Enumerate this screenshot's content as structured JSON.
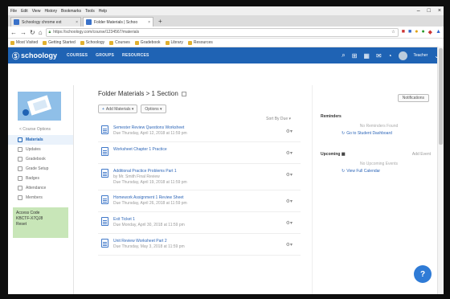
{
  "browser": {
    "menu": [
      "File",
      "Edit",
      "View",
      "History",
      "Bookmarks",
      "Tools",
      "Help"
    ],
    "window_controls": [
      "–",
      "□",
      "×"
    ],
    "tabs": [
      {
        "title": "Schoology chrome ext",
        "active": false
      },
      {
        "title": "Folder Materials | Schoo",
        "active": true
      }
    ],
    "new_tab": "+",
    "url": "https://schoology.com/course/1234567/materials",
    "bookmarks": [
      "Most Visited",
      "Getting Started",
      "Schoology",
      "Courses",
      "Gradebook",
      "Library",
      "Resources"
    ]
  },
  "appbar": {
    "logo": "schoology",
    "nav": [
      "COURSES",
      "GROUPS",
      "RESOURCES"
    ],
    "user_name": "Teacher"
  },
  "sidebar": {
    "back_label": "< Course Options",
    "items": [
      {
        "label": "Materials",
        "active": true
      },
      {
        "label": "Updates",
        "active": false
      },
      {
        "label": "Gradebook",
        "active": false
      },
      {
        "label": "Grade Setup",
        "active": false
      },
      {
        "label": "Badges",
        "active": false
      },
      {
        "label": "Attendance",
        "active": false
      },
      {
        "label": "Members",
        "active": false
      }
    ],
    "access_code": {
      "label": "Access Code",
      "code": "KBCTF-X7QJ8",
      "action": "Reset"
    }
  },
  "main": {
    "folder_title": "Folder Materials > 1 Section",
    "add_materials": "Add Materials",
    "options": "Options",
    "sort_label": "Sort By Due ▾",
    "items": [
      {
        "title": "Semester Review Questions Worksheet",
        "sub": "Due Thursday, April 12, 2018 at 11:59 pm"
      },
      {
        "title": "Worksheet Chapter 1 Practice",
        "sub": ""
      },
      {
        "title": "Additional Practice Problems Part 1",
        "sub": "by Mr. Smith Final Review",
        "sub2": "Due Thursday, April 19, 2018 at 11:59 pm"
      },
      {
        "title": "Homework Assignment 1 Review Sheet",
        "sub": "Due Thursday, April 26, 2018 at 11:59 pm"
      },
      {
        "title": "Exit Ticket 1",
        "sub": "Due Monday, April 30, 2018 at 11:59 pm"
      },
      {
        "title": "Unit Review Worksheet Part 2",
        "sub": "Due Thursday, May 3, 2018 at 11:59 pm"
      }
    ]
  },
  "right": {
    "notif_button": "Notifications",
    "reminders": {
      "title": "Reminders",
      "empty": "No Reminders Found",
      "link": "Go to Student Dashboard"
    },
    "upcoming": {
      "title": "Upcoming",
      "add": "Add Event",
      "empty": "No Upcoming Events",
      "link": "View Full Calendar"
    }
  },
  "help_label": "?"
}
